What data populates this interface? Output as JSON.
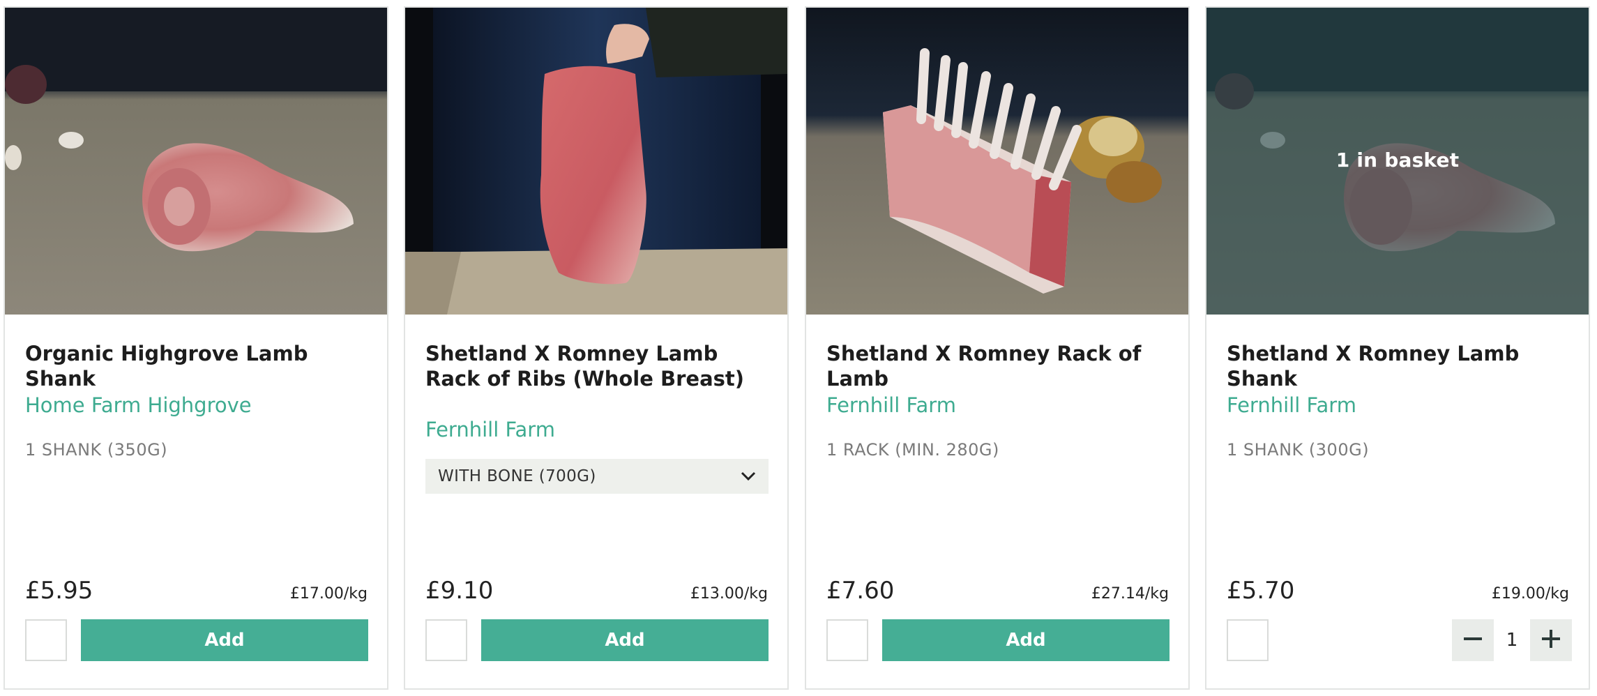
{
  "products": [
    {
      "title": "Organic Highgrove Lamb Shank",
      "farm": "Home Farm Highgrove",
      "unit": "1 SHANK (350G)",
      "price": "£5.95",
      "price_per_kg": "£17.00/kg",
      "add_label": "Add"
    },
    {
      "title": "Shetland X Romney Lamb Rack of Ribs (Whole Breast)",
      "farm": "Fernhill Farm",
      "variant_selected": "WITH BONE (700G)",
      "price": "£9.10",
      "price_per_kg": "£13.00/kg",
      "add_label": "Add"
    },
    {
      "title": "Shetland X Romney Rack of Lamb",
      "farm": "Fernhill Farm",
      "unit": "1 RACK (MIN. 280G)",
      "price": "£7.60",
      "price_per_kg": "£27.14/kg",
      "add_label": "Add"
    },
    {
      "title": "Shetland X Romney Lamb Shank",
      "farm": "Fernhill Farm",
      "unit": "1 SHANK (300G)",
      "price": "£5.70",
      "price_per_kg": "£19.00/kg",
      "in_basket_label": "1 in basket",
      "quantity": "1"
    }
  ],
  "colors": {
    "accent": "#45ae95",
    "farm_link": "#3eab90",
    "overlay": "#284b4e"
  },
  "icons": {
    "dropdown": "chevron-down-icon",
    "decrease": "minus-icon",
    "increase": "plus-icon"
  }
}
